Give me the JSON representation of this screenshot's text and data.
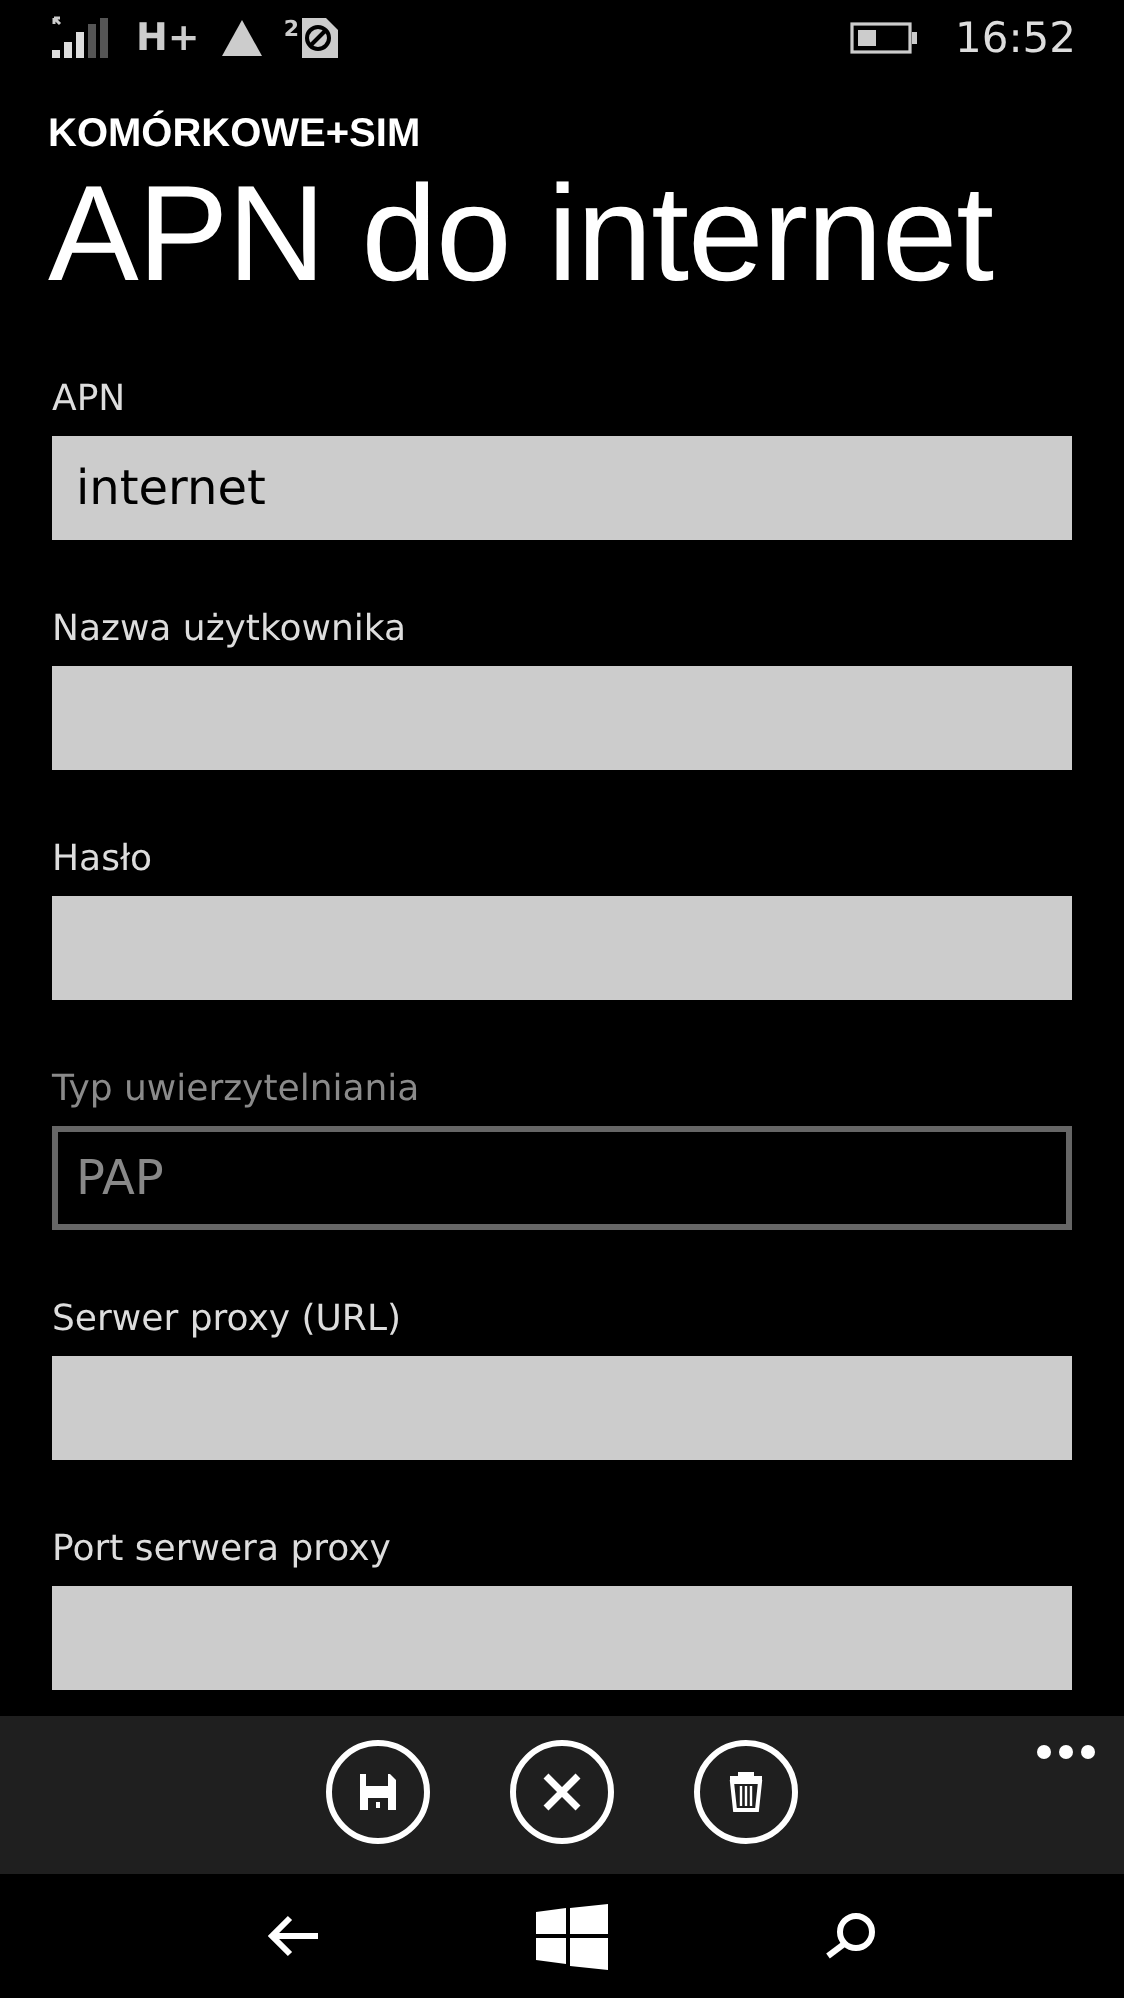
{
  "status_bar": {
    "network": "H+",
    "sim_number": "2",
    "time": "16:52"
  },
  "header": {
    "section": "KOMÓRKOWE+SIM",
    "title": "APN do internet"
  },
  "fields": [
    {
      "label": "APN",
      "value": "internet",
      "disabled": false
    },
    {
      "label": "Nazwa użytkownika",
      "disabled": false
    },
    {
      "label": "Hasło",
      "disabled": false
    },
    {
      "label": "Typ uwierzytelniania",
      "value": "PAP",
      "disabled": true
    },
    {
      "label": "Serwer proxy (URL)",
      "disabled": false
    },
    {
      "label": "Port serwera proxy",
      "disabled": false
    }
  ],
  "app_bar": {
    "buttons": [
      {
        "kind": "save"
      },
      {
        "kind": "cancel"
      },
      {
        "kind": "delete"
      }
    ]
  }
}
